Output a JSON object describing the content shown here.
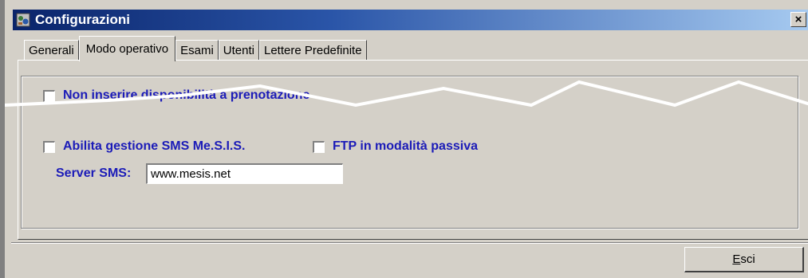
{
  "window": {
    "title": "Configurazioni",
    "close_label": "×"
  },
  "tabs": [
    {
      "label": "Generali",
      "active": false
    },
    {
      "label": "Modo operativo",
      "active": true
    },
    {
      "label": "Esami",
      "active": false
    },
    {
      "label": "Utenti",
      "active": false
    },
    {
      "label": "Lettere Predefinite",
      "active": false
    }
  ],
  "options": {
    "no_insert_availability": {
      "label": "Non inserire disponibilità a prenotazione",
      "checked": false
    },
    "sms_management": {
      "label": "Abilita gestione SMS Me.S.I.S.",
      "checked": false
    },
    "ftp_passive": {
      "label": "FTP in modalità passiva",
      "checked": false
    }
  },
  "server_sms": {
    "label": "Server SMS:",
    "value": "www.mesis.net"
  },
  "footer": {
    "exit_label_prefix": "E",
    "exit_label_rest": "sci"
  },
  "colors": {
    "label_blue": "#1b1bb8",
    "window_bg": "#d4d0c8",
    "titlebar": "#0a246a"
  }
}
